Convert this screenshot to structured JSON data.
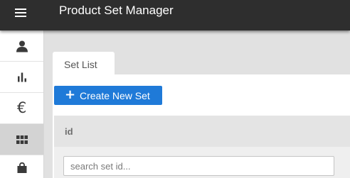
{
  "header": {
    "title": "Product Set Manager",
    "menu_icon": "hamburger-menu-icon",
    "background": "#2e2e2e"
  },
  "sidebar": {
    "active_item": "product-sets",
    "items": [
      {
        "id": "account",
        "icon": "user-icon"
      },
      {
        "id": "stats",
        "icon": "bar-chart-icon"
      },
      {
        "id": "pricing",
        "icon": "euro-icon",
        "glyph": "€"
      },
      {
        "id": "product-sets",
        "icon": "grid-icon"
      },
      {
        "id": "shop",
        "icon": "shopping-bag-icon"
      }
    ]
  },
  "tabs": [
    {
      "label": "Set List",
      "active": true
    }
  ],
  "toolbar": {
    "create_icon": "plus-icon",
    "create_label": "Create New Set",
    "accent_color": "#1f7ad8"
  },
  "table": {
    "columns": [
      {
        "label": "id"
      }
    ],
    "search": {
      "placeholder": "search set id...",
      "value": ""
    }
  }
}
